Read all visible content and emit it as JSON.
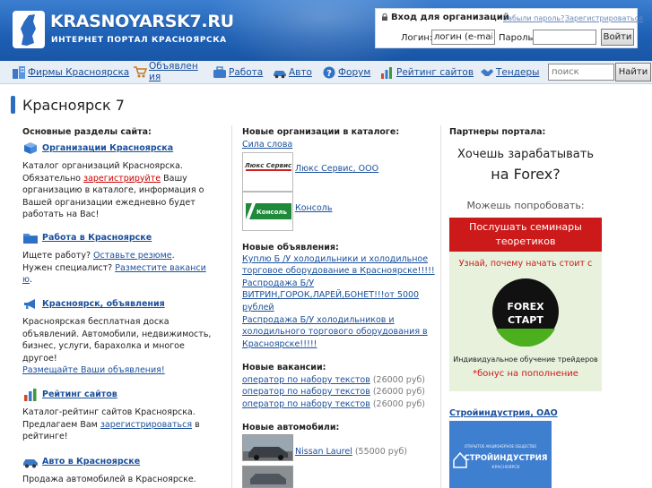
{
  "header": {
    "site_name": "KRASNOYARSK7.RU",
    "tagline": "ИНТЕРНЕТ ПОРТАЛ КРАСНОЯРСКА",
    "colors": {
      "header_blue": "#1d5fb4",
      "link": "#1a4f9c",
      "accent_red": "#cc0000"
    }
  },
  "login": {
    "title": "Вход для организаций",
    "forgot": "Забыли пароль?",
    "register": "Зарегистрироваться",
    "login_label": "Логин:",
    "login_value": "логин (e-mail)",
    "password_label": "Пароль:",
    "submit": "Войти"
  },
  "nav": {
    "items": [
      {
        "label": "Фирмы Красноярска",
        "icon": "buildings-icon"
      },
      {
        "label": "Объявления",
        "icon": "cart-icon"
      },
      {
        "label": "Работа",
        "icon": "briefcase-icon"
      },
      {
        "label": "Авто",
        "icon": "car-icon"
      },
      {
        "label": "Форум",
        "icon": "help-icon"
      },
      {
        "label": "Рейтинг сайтов",
        "icon": "chart-icon"
      },
      {
        "label": "Тендеры",
        "icon": "handshake-icon"
      }
    ],
    "search_placeholder": "поиск",
    "search_button": "Найти"
  },
  "page_title": "Красноярск 7",
  "main_sections": {
    "title": "Основные разделы сайта:",
    "orgs": {
      "title": "Организации Красноярска",
      "l1": "Каталог организаций Красноярска.",
      "l2a": "Обязательно ",
      "l2link": "зарегистрируйте",
      "l2b": " Вашу",
      "l3": "организацию в каталоге, информация о",
      "l4": "Вашей организации ежедневно будет",
      "l5": "работать на Вас!"
    },
    "jobs": {
      "title": "Работа в Красноярске",
      "l1a": "Ищете работу? ",
      "l1link": "Оставьте резюме",
      "l1b": ".",
      "l2a": "Нужен специалист? ",
      "l2link": "Разместите ваканси",
      "l3link": "ю",
      "l3b": "."
    },
    "ads": {
      "title": "Красноярск, объявления",
      "l1": "Красноярская бесплатная доска",
      "l2": "объявлений. Автомобили, недвижимость,",
      "l3": "бизнес, услуги, барахолка и многое",
      "l4": "другое!",
      "l5link": "Размещайте Ваши объявления!"
    },
    "rating": {
      "title": "Рейтинг сайтов",
      "l1": "Каталог-рейтинг сайтов Красноярска.",
      "l2a": "Предлагаем Вам ",
      "l2link": "зарегистрироваться",
      "l2b": " в",
      "l3": "рейтинге!"
    },
    "auto": {
      "title": "Авто в Красноярске",
      "l1": "Продажа автомобилей в Красноярске."
    }
  },
  "new_orgs": {
    "title": "Новые организации в каталоге:",
    "first_link": "Сила слова",
    "items": [
      {
        "name": "Люкс Сервис, ООО",
        "logo_text": "Люкс Сервис"
      },
      {
        "name": "Консоль",
        "logo_text": "Консоль"
      }
    ]
  },
  "new_ads": {
    "title": "Новые объявления:",
    "lines": [
      "Куплю Б /У холодильники и холодильное",
      "торговое оборудование в Красноярске!!!!!",
      "Распродажа Б/У",
      "ВИТРИН,ГОРОК,ЛАРЕЙ,БОНЕТ!!!от 5000",
      "рублей",
      "Распродажа Б/У холодильников и",
      "холодильного торгового оборудования в",
      "Красноярске!!!!!"
    ]
  },
  "new_vacancies": {
    "title": "Новые вакансии:",
    "items": [
      {
        "title": "оператор по набору текстов",
        "salary": " (26000 руб)"
      },
      {
        "title": "оператор по набору текстов",
        "salary": " (26000 руб)"
      },
      {
        "title": "оператор по набору текстов",
        "salary": " (26000 руб)"
      }
    ]
  },
  "new_cars": {
    "title": "Новые автомобили:",
    "items": [
      {
        "name": "Nissan Laurel",
        "price": " (55000 руб)"
      }
    ]
  },
  "partners": {
    "title": "Партнеры портала:",
    "banner": {
      "l1": "Хочешь зарабатывать",
      "l2": "на Forex?",
      "l3": "Можешь попробовать:",
      "btn1": "Послушать семинары",
      "btn2": "теоретиков",
      "l4": "Узнай, почему начать стоит с",
      "logo1": "FOREX",
      "logo2": "СТАРТ",
      "l5": "Индивидуальное обучение трейдеров",
      "l6": "*бонус на пополнение"
    },
    "partner_name": "Стройиндустрия, ОАО",
    "partner_logo_small": "ОТКРЫТОЕ АКЦИОНЕРНОЕ ОБЩЕСТВО",
    "partner_logo_main": "СТРОЙИНДУСТРИЯ",
    "partner_logo_city": "КРАСНОЯРСК"
  }
}
